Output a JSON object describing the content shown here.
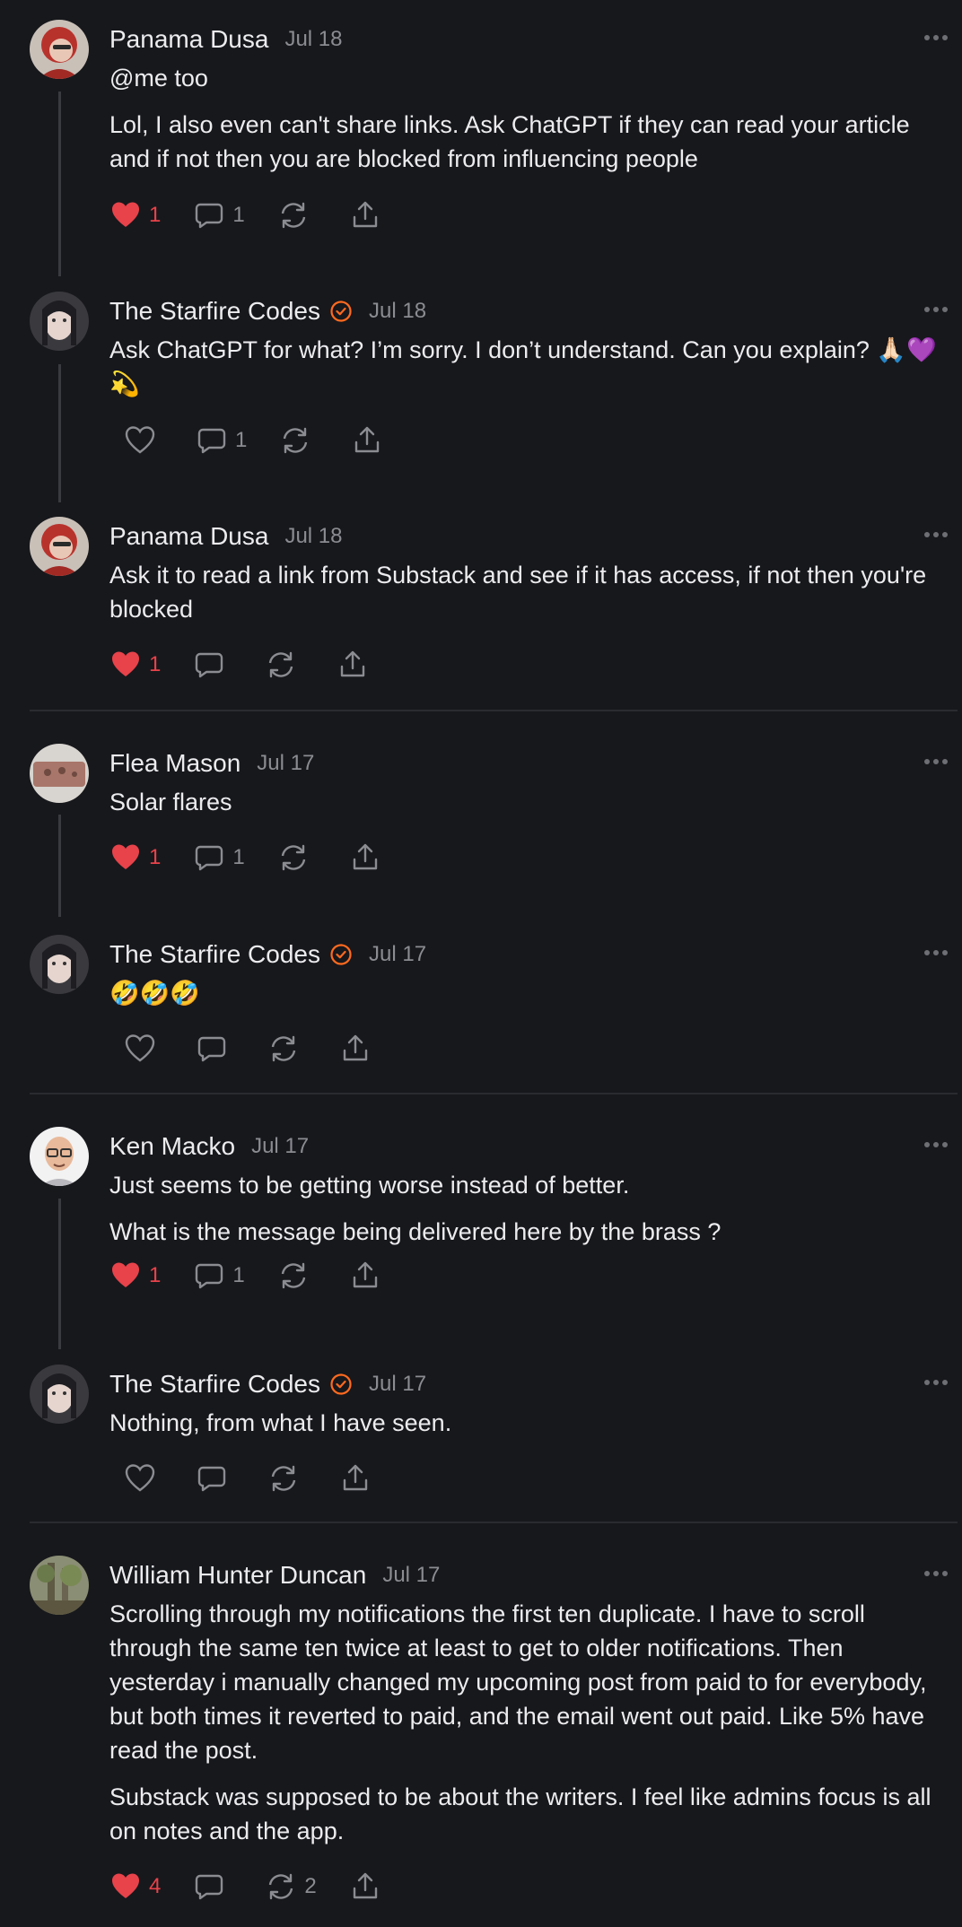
{
  "comments": [
    {
      "name": "Panama Dusa",
      "date": "Jul 18",
      "verified": false,
      "paras": [
        "@me too",
        "Lol, I also even can't share links. Ask ChatGPT if they can read your article and if not then you are blocked from influencing people"
      ],
      "likes": "1",
      "replies": "1",
      "restacks": ""
    },
    {
      "name": "The Starfire Codes",
      "date": "Jul 18",
      "verified": true,
      "paras": [
        "Ask ChatGPT for what? I’m sorry. I don’t understand. Can you explain? 🙏🏻💜💫"
      ],
      "likes": "",
      "replies": "1",
      "restacks": ""
    },
    {
      "name": "Panama Dusa",
      "date": "Jul 18",
      "verified": false,
      "paras": [
        "Ask it to read a link from Substack and see if it has access, if not then you're blocked"
      ],
      "likes": "1",
      "replies": "",
      "restacks": ""
    },
    {
      "name": "Flea Mason",
      "date": "Jul 17",
      "verified": false,
      "paras": [
        "Solar flares"
      ],
      "likes": "1",
      "replies": "1",
      "restacks": ""
    },
    {
      "name": "The Starfire Codes",
      "date": "Jul 17",
      "verified": true,
      "paras": [
        "🤣🤣🤣"
      ],
      "likes": "",
      "replies": "",
      "restacks": ""
    },
    {
      "name": "Ken Macko",
      "date": "Jul 17",
      "verified": false,
      "paras": [
        "Just seems to be getting worse instead of better.",
        "What is the message being delivered here by the brass ?"
      ],
      "likes": "1",
      "replies": "1",
      "restacks": ""
    },
    {
      "name": "The Starfire Codes",
      "date": "Jul 17",
      "verified": true,
      "paras": [
        "Nothing, from what I have seen."
      ],
      "likes": "",
      "replies": "",
      "restacks": ""
    },
    {
      "name": "William Hunter Duncan",
      "date": "Jul 17",
      "verified": false,
      "paras": [
        "Scrolling through my notifications the first ten duplicate. I have to scroll through the same ten twice at least to get to older notifications. Then yesterday i manually changed my upcoming post from paid to for everybody, but both times it reverted to paid, and the email went out paid. Like 5% have read the post.",
        "Substack was supposed to be about the writers. I feel like admins focus is all on notes and the app."
      ],
      "likes": "4",
      "replies": "",
      "restacks": "2"
    }
  ],
  "colors": {
    "like": "#e8424a",
    "verified": "#ff6a1f",
    "muted": "#8b8c92",
    "background": "#17181c"
  },
  "icons": [
    "heart-icon",
    "comment-icon",
    "restack-icon",
    "share-icon",
    "more-icon",
    "verified-icon"
  ]
}
